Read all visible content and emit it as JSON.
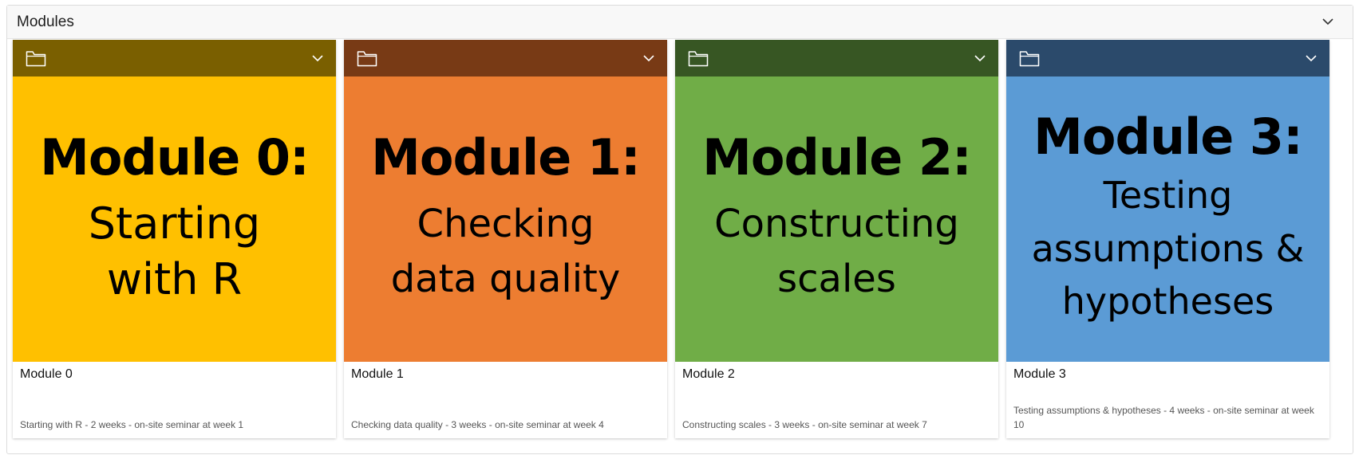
{
  "panel": {
    "title": "Modules",
    "toggle_icon": "chevron-down-icon"
  },
  "modules": [
    {
      "heading": "Module 0:",
      "subtitle": "Starting with R",
      "name": "Module 0",
      "description": "Starting with R - 2 weeks - on-site seminar at week 1",
      "bar_color": "#7a5f00",
      "image_color": "#ffc000"
    },
    {
      "heading": "Module 1:",
      "subtitle": "Checking data quality",
      "name": "Module 1",
      "description": "Checking data quality - 3 weeks - on-site seminar at week 4",
      "bar_color": "#783a15",
      "image_color": "#ed7d31"
    },
    {
      "heading": "Module 2:",
      "subtitle": "Constructing scales",
      "name": "Module 2",
      "description": "Constructing scales - 3 weeks - on-site seminar at week 7",
      "bar_color": "#375623",
      "image_color": "#70ad47"
    },
    {
      "heading": "Module 3:",
      "subtitle": "Testing assumptions & hypotheses",
      "name": "Module 3",
      "description": "Testing assumptions & hypotheses - 4 weeks - on-site seminar at week 10",
      "bar_color": "#2b4a6b",
      "image_color": "#5b9bd5"
    }
  ],
  "icons": {
    "card_folder": "folder-icon",
    "card_menu": "chevron-down-icon"
  }
}
